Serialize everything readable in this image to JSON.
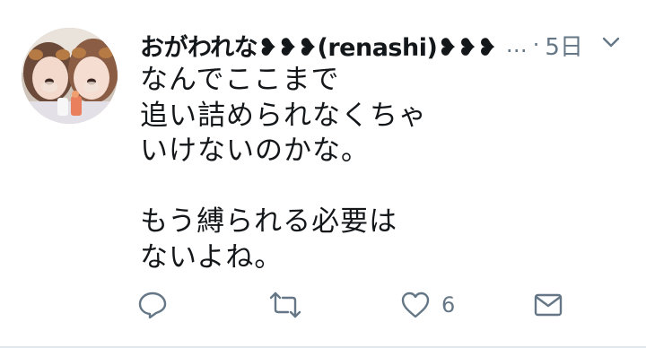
{
  "tweet": {
    "display_name": "おがわれな❥❥❥(renashi)❥❥❥",
    "handle_ellipsis": "…",
    "separator": "·",
    "timestamp": "5日",
    "body_lines": [
      "なんでここまで",
      "追い詰められなくちゃ",
      "いけないのかな。",
      "",
      "もう縛られる必要は",
      "ないよね。"
    ],
    "like_count": "6"
  },
  "icons": {
    "reply": "reply-icon",
    "retweet": "retweet-icon",
    "like": "heart-icon",
    "dm": "mail-icon",
    "caret": "chevron-down-icon"
  },
  "colors": {
    "text": "#14171a",
    "secondary": "#657786",
    "icon": "#657786",
    "divider": "#e1e8ed"
  }
}
